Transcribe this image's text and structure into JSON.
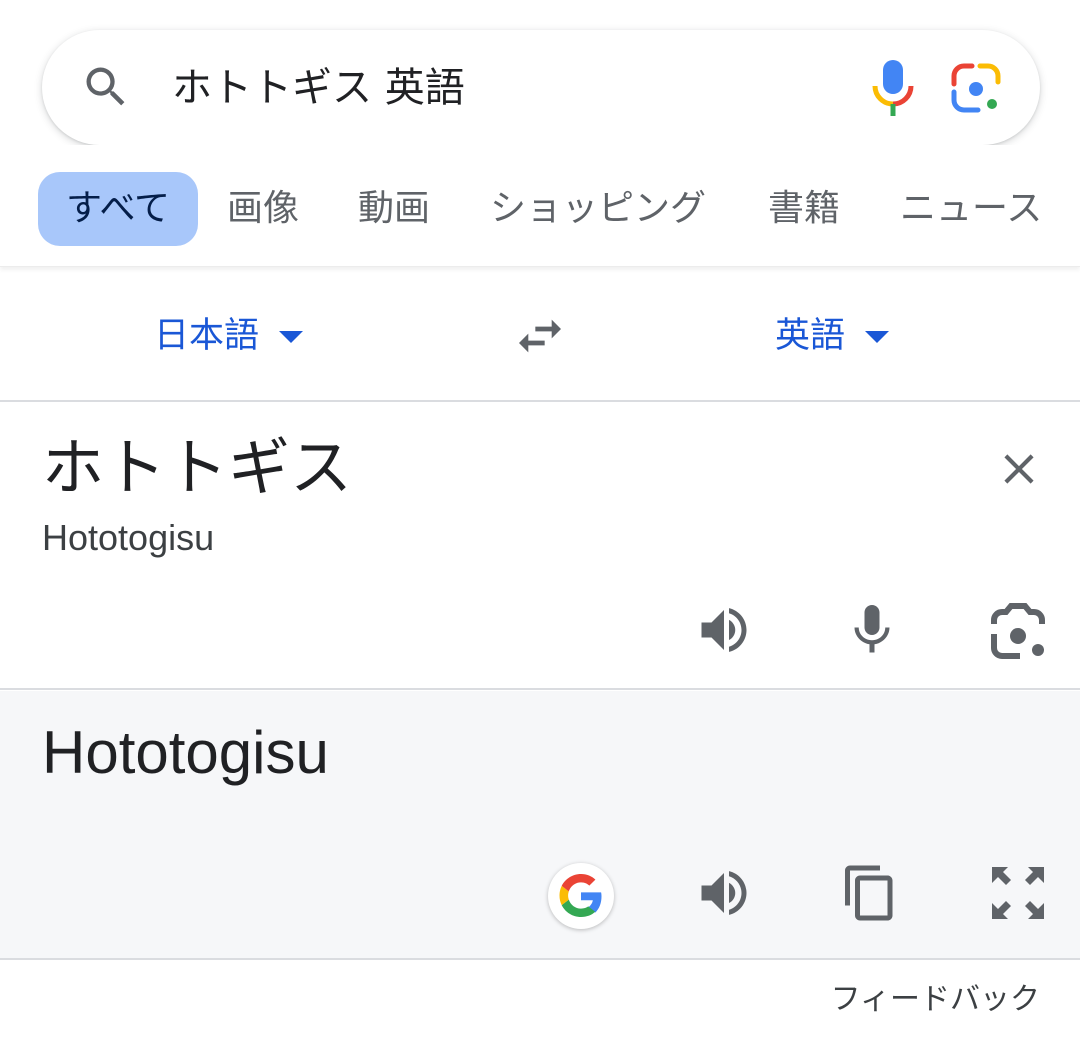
{
  "search": {
    "query": "ホトトギス 英語"
  },
  "tabs": [
    {
      "label": "すべて",
      "active": true
    },
    {
      "label": "画像"
    },
    {
      "label": "動画"
    },
    {
      "label": "ショッピング"
    },
    {
      "label": "書籍"
    },
    {
      "label": "ニュース"
    }
  ],
  "translate": {
    "source_language": "日本語",
    "target_language": "英語",
    "source_text": "ホトトギス",
    "source_romanization": "Hototogisu",
    "target_text": "Hototogisu"
  },
  "footer": {
    "feedback_label": "フィードバック"
  },
  "colors": {
    "accent_blue": "#1a57d6",
    "active_tab_bg": "#a8c7fa",
    "icon_gray": "#5f6368",
    "target_panel_bg": "#f6f7f9"
  },
  "icons": [
    "search-icon",
    "mic-icon",
    "google-lens-icon",
    "swap-languages-icon",
    "clear-icon",
    "speaker-icon",
    "camera-icon",
    "google-logo-icon",
    "copy-icon",
    "fullscreen-icon"
  ]
}
